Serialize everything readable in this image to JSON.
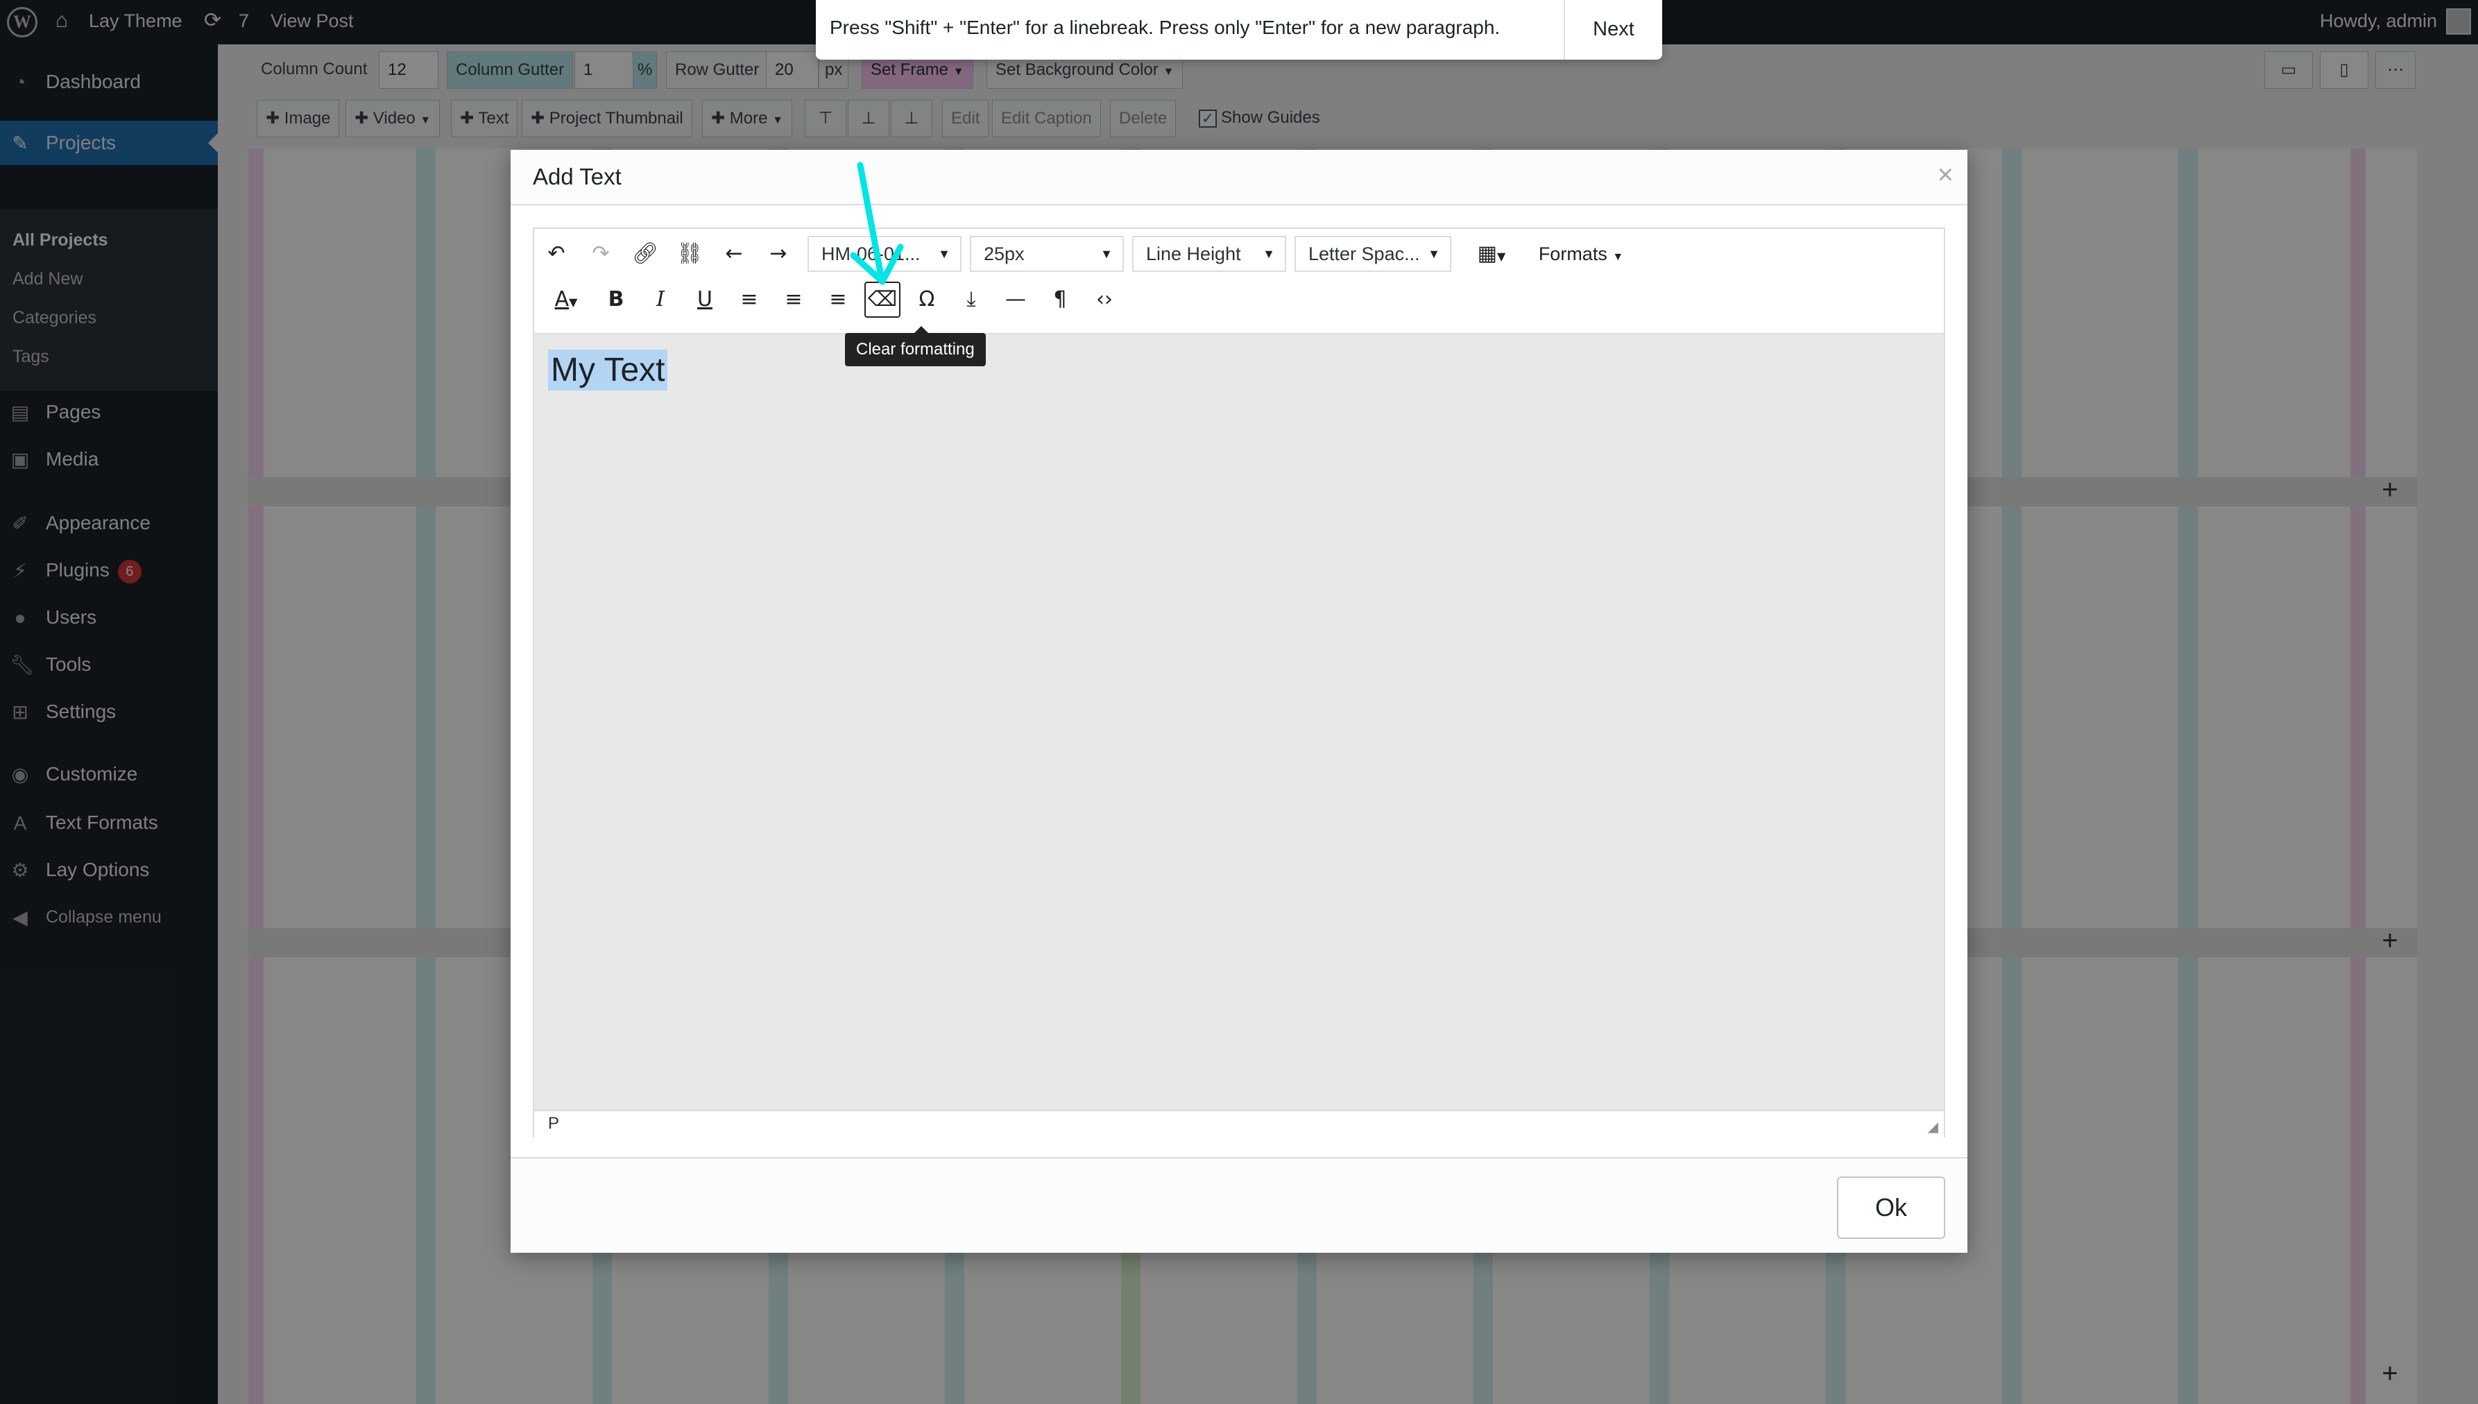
{
  "adminbar": {
    "site_name": "Lay Theme",
    "updates_count": "7",
    "view_post": "View Post",
    "howdy": "Howdy, admin"
  },
  "sidebar": {
    "items": [
      {
        "label": "Dashboard",
        "icon": "dashboard-icon"
      },
      {
        "label": "Projects",
        "icon": "pushpin-icon"
      },
      {
        "label": "Pages",
        "icon": "pages-icon"
      },
      {
        "label": "Media",
        "icon": "media-icon"
      },
      {
        "label": "Appearance",
        "icon": "brush-icon"
      },
      {
        "label": "Plugins",
        "icon": "plugin-icon",
        "badge": "6"
      },
      {
        "label": "Users",
        "icon": "users-icon"
      },
      {
        "label": "Tools",
        "icon": "wrench-icon"
      },
      {
        "label": "Settings",
        "icon": "settings-icon"
      },
      {
        "label": "Customize",
        "icon": "eye-icon"
      },
      {
        "label": "Text Formats",
        "icon": "text-format-icon"
      },
      {
        "label": "Lay Options",
        "icon": "gear-icon"
      },
      {
        "label": "Collapse menu",
        "icon": "collapse-icon"
      }
    ],
    "submenu": [
      "All Projects",
      "Add New",
      "Categories",
      "Tags"
    ]
  },
  "builder": {
    "column_count_label": "Column Count",
    "column_count_value": "12",
    "column_gutter_label": "Column Gutter",
    "column_gutter_value": "1",
    "column_gutter_unit": "%",
    "row_gutter_label": "Row Gutter",
    "row_gutter_value": "20",
    "row_gutter_unit": "px",
    "set_frame": "Set Frame",
    "set_bg": "Set Background Color",
    "add_image": "Image",
    "add_video": "Video",
    "add_text": "Text",
    "add_thumb": "Project Thumbnail",
    "more": "More",
    "edit": "Edit",
    "edit_caption": "Edit Caption",
    "delete": "Delete",
    "show_guides": "Show Guides"
  },
  "toast": {
    "message": "Press \"Shift\" + \"Enter\" for a linebreak. Press only \"Enter\" for a new paragraph.",
    "next": "Next"
  },
  "modal": {
    "title": "Add Text",
    "close": "×",
    "font_family": "HM-06-01...",
    "font_size": "25px",
    "line_height": "Line Height",
    "letter_spacing": "Letter Spac...",
    "formats": "Formats",
    "tooltip": "Clear formatting",
    "content": "My Text",
    "status_path": "P",
    "ok": "Ok"
  },
  "colors": {
    "admin_dark": "#1d2327",
    "accent_blue": "#2271b1",
    "annotation_cyan": "#00e5e5",
    "grid_teal": "#d3f0f0",
    "frame_pink": "#f7c3ef"
  }
}
